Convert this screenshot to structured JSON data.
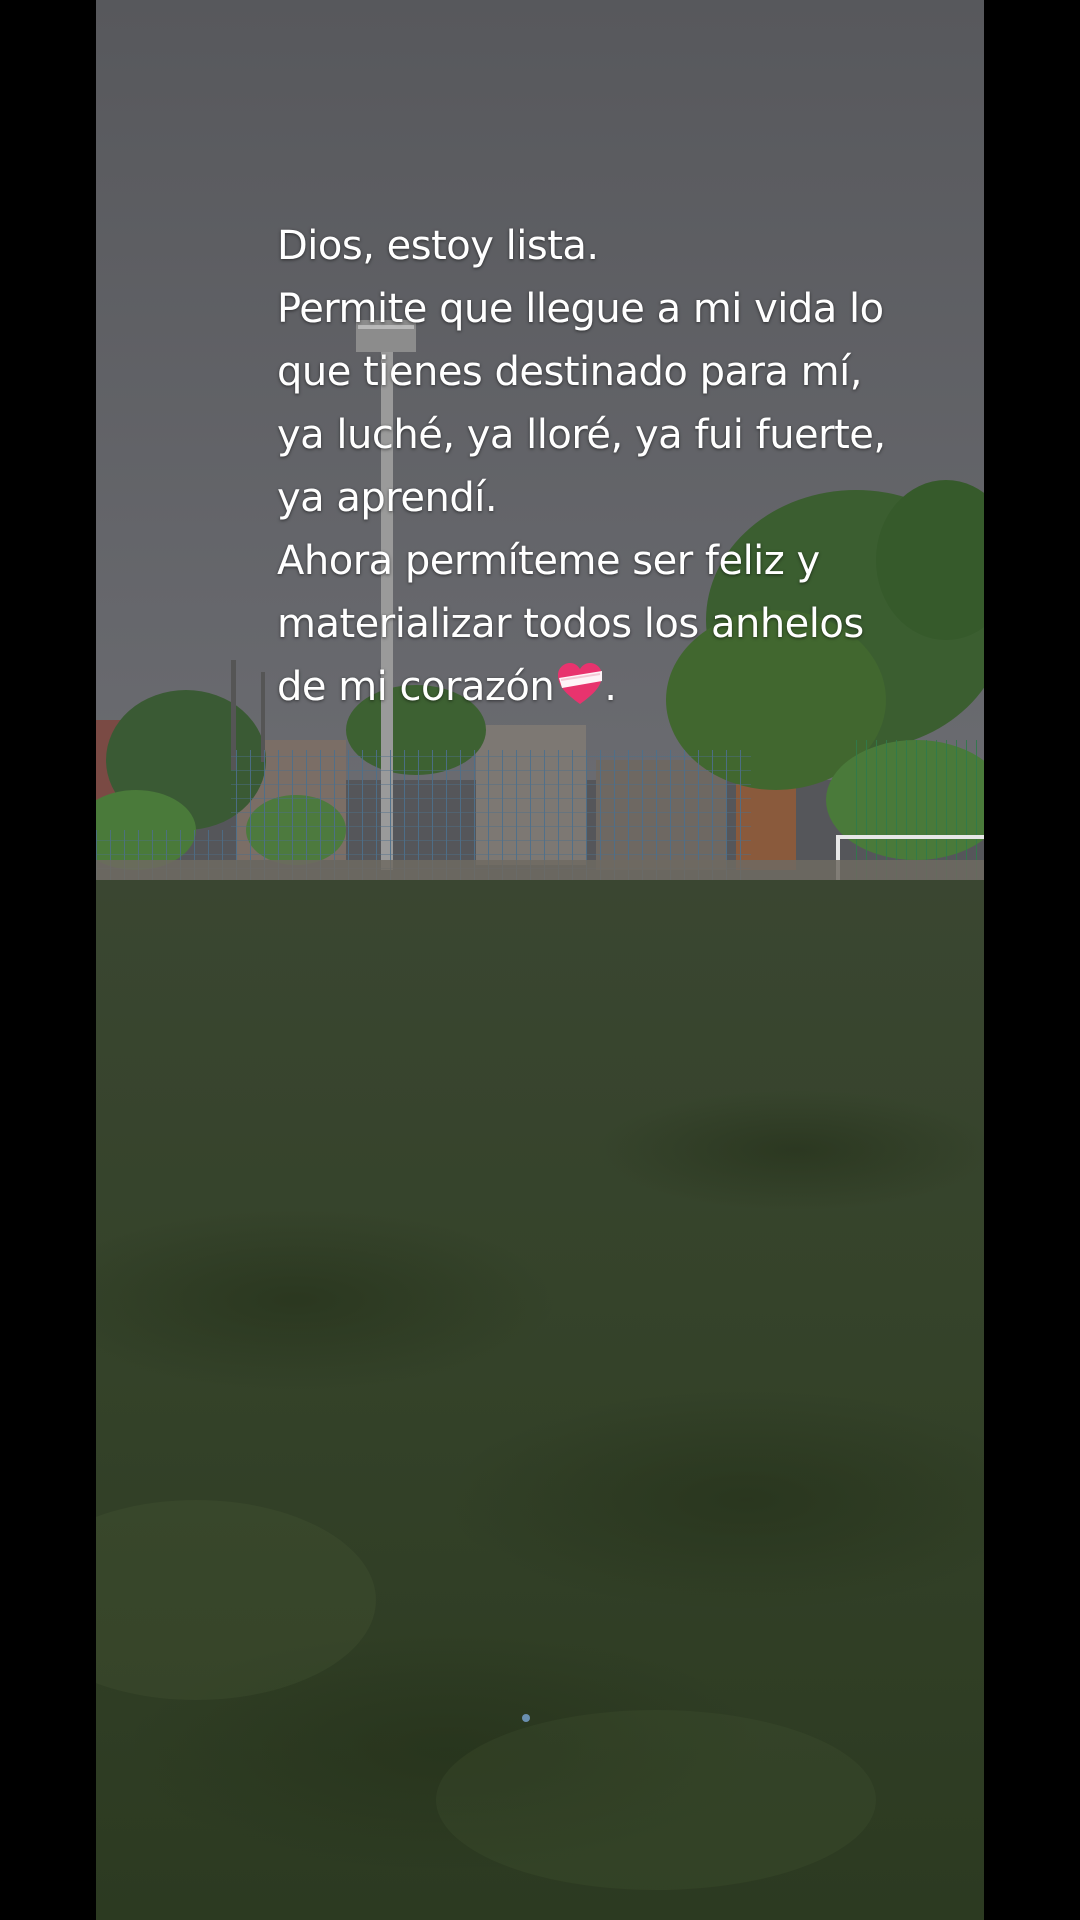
{
  "caption": {
    "lines": [
      "Dios, estoy lista.",
      "Permite que llegue a mi vida lo",
      "que tienes destinado para mí,",
      "ya luché, ya lloré, ya fui fuerte,",
      "ya aprendí.",
      "Ahora permíteme ser feliz y",
      "materializar todos los anhelos",
      "de mi corazón"
    ],
    "trailing_punctuation": "."
  },
  "icons": {
    "heart": "bandaged-heart-icon"
  },
  "colors": {
    "letterbox": "#000000",
    "sky": "#5a5b5f",
    "turf": "#3b4a2c",
    "caption_text": "#ffffff",
    "heart": "#e8336e"
  }
}
